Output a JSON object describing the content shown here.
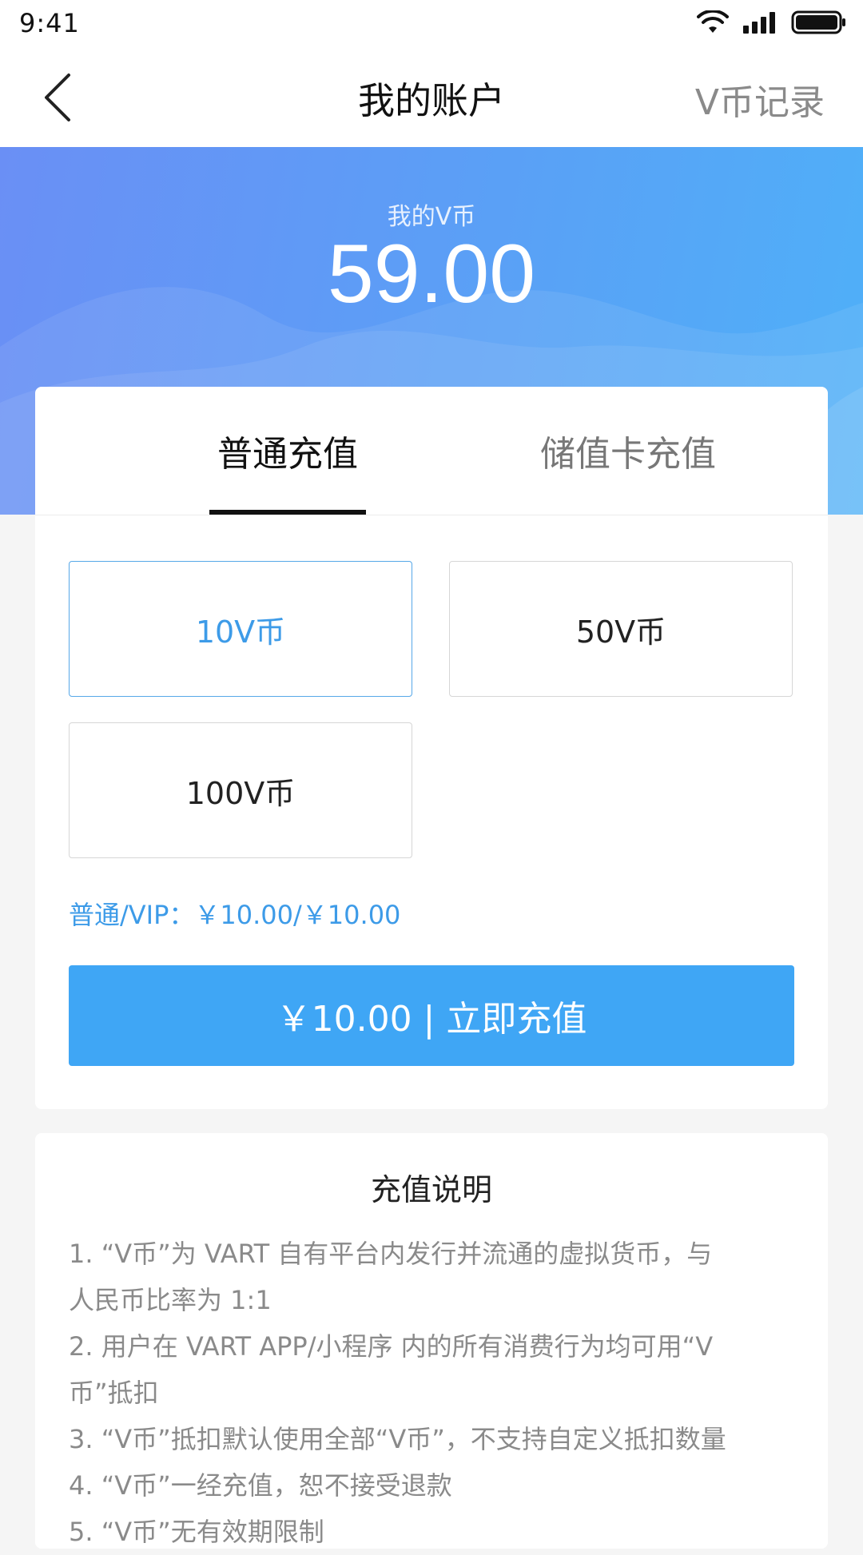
{
  "status_bar": {
    "time": "9:41"
  },
  "nav": {
    "title": "我的账户",
    "right_link": "V币记录"
  },
  "balance": {
    "label": "我的V币",
    "value": "59.00"
  },
  "tabs": [
    {
      "label": "普通充值",
      "active": true
    },
    {
      "label": "储值卡充值",
      "active": false
    }
  ],
  "options": [
    {
      "label": "10V币",
      "selected": true
    },
    {
      "label": "50V币",
      "selected": false
    },
    {
      "label": "100V币",
      "selected": false
    }
  ],
  "price_note": "普通/VIP：￥10.00/￥10.00",
  "recharge_button": "￥10.00 | 立即充值",
  "info": {
    "title": "充值说明",
    "lines": [
      "1. “V币”为 VART 自有平台内发行并流通的虚拟货币，与",
      "人民币比率为 1:1",
      "2. 用户在 VART APP/小程序 内的所有消费行为均可用“V",
      "币”抵扣",
      "3. “V币”抵扣默认使用全部“V币”，不支持自定义抵扣数量",
      "4. “V币”一经充值，恕不接受退款",
      "5. “V币”无有效期限制"
    ]
  },
  "colors": {
    "accent": "#3fa6f5",
    "accent_text": "#3d9be8",
    "hero_start": "#6a8ff5",
    "hero_end": "#4fb0f8"
  }
}
